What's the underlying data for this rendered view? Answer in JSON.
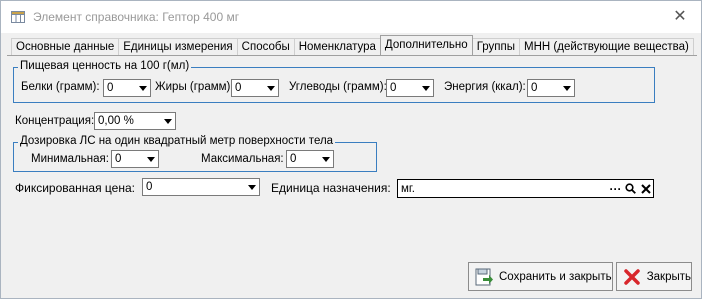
{
  "window": {
    "title": "Элемент справочника: Гептор 400 мг"
  },
  "tabs": [
    {
      "label": "Основные данные",
      "active": false
    },
    {
      "label": "Единицы измерения",
      "active": false
    },
    {
      "label": "Способы",
      "active": false
    },
    {
      "label": "Номенклатура",
      "active": false
    },
    {
      "label": "Дополнительно",
      "active": true
    },
    {
      "label": "Группы",
      "active": false
    },
    {
      "label": "МНН (действующие вещества)",
      "active": false
    }
  ],
  "nutrition": {
    "title": "Пищевая ценность на 100 г(мл)",
    "protein_label": "Белки (грамм):",
    "protein_value": "0",
    "fat_label": "Жиры (грамм):",
    "fat_value": "0",
    "carbs_label": "Углеводы (грамм):",
    "carbs_value": "0",
    "energy_label": "Энергия (ккал):",
    "energy_value": "0"
  },
  "concentration": {
    "label": "Концентрация:",
    "value": "0,00 %"
  },
  "dosage": {
    "title": "Дозировка ЛС на один квадратный метр поверхности тела",
    "min_label": "Минимальная:",
    "min_value": "0",
    "max_label": "Максимальная:",
    "max_value": "0"
  },
  "fixed_price": {
    "label": "Фиксированная цена:",
    "value": "0"
  },
  "unit": {
    "label": "Единица назначения:",
    "value": "мг."
  },
  "buttons": {
    "save_close": "Сохранить и закрыть",
    "close": "Закрыть"
  },
  "colors": {
    "group_border": "#3a7ec0",
    "close_icon": "#d8262b",
    "save_icon": "#3a8d3a"
  }
}
